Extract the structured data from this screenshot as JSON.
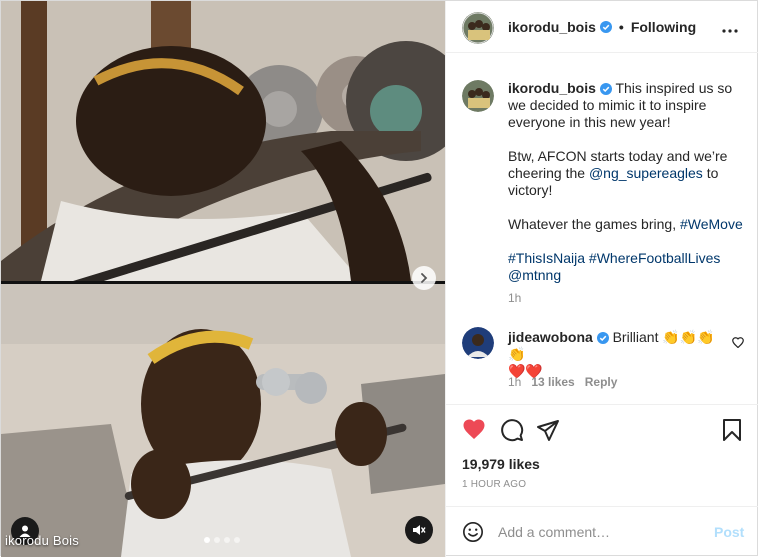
{
  "post": {
    "username": "ikorodu_bois",
    "verified": true,
    "follow_status": "Following",
    "more_icon": "more-horizontal-icon"
  },
  "media": {
    "watermark": "ikorodu Bois",
    "slide_count": 4,
    "active_slide": 1,
    "icons": [
      "chevron-right-icon",
      "user-tag-icon",
      "mute-icon"
    ]
  },
  "caption": {
    "username": "ikorodu_bois",
    "line1": "This inspired us so we decided to mimic it to inspire everyone in this new year!",
    "p2_before": "Btw, AFCON starts today and we’re cheering the ",
    "p2_mention": "@ng_supereagles",
    "p2_after": " to victory!",
    "p3_before": "Whatever the games bring, ",
    "p3_tag": "#WeMove",
    "p4_tag1": "#ThisIsNaija",
    "p4_tag2": "#WhereFootballLives",
    "p4_mention": "@mtnng",
    "time": "1h"
  },
  "comment": {
    "username": "jideawobona",
    "text": "Brilliant 👏👏👏👏",
    "text2": "❤️❤️",
    "time": "1h",
    "likes": "13 likes",
    "reply": "Reply"
  },
  "actions": {
    "like_count": "19,979 likes",
    "date": "1 HOUR AGO",
    "liked": true,
    "like_color": "#ed4956"
  },
  "add_comment": {
    "placeholder": "Add a comment…",
    "post_label": "Post",
    "post_color": "#b2dffc"
  }
}
